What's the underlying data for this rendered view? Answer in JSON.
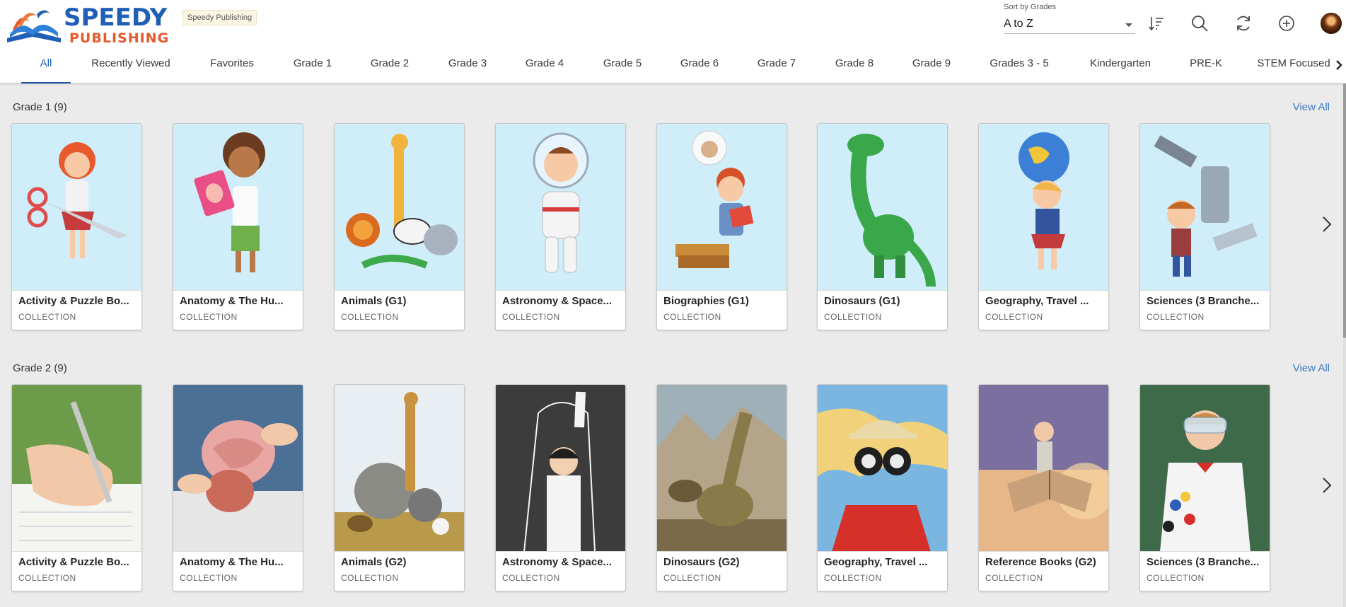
{
  "brand": {
    "line1": "SPEEDY",
    "line2": "PUBLISHING",
    "tenant_badge": "Speedy Publishing",
    "colors": {
      "blue": "#1f5fb8",
      "orange": "#e8592a"
    }
  },
  "sort": {
    "label": "Sort by Grades",
    "value": "A to Z"
  },
  "toolbar": {
    "icons": [
      "sort-order-icon",
      "search-icon",
      "refresh-icon",
      "add-icon",
      "avatar"
    ]
  },
  "tabs": [
    {
      "label": "All",
      "active": true
    },
    {
      "label": "Recently Viewed"
    },
    {
      "label": "Favorites"
    },
    {
      "label": "Grade 1"
    },
    {
      "label": "Grade 2"
    },
    {
      "label": "Grade 3"
    },
    {
      "label": "Grade 4"
    },
    {
      "label": "Grade 5"
    },
    {
      "label": "Grade 6"
    },
    {
      "label": "Grade 7"
    },
    {
      "label": "Grade 8"
    },
    {
      "label": "Grade 9"
    },
    {
      "label": "Grades 3 - 5"
    },
    {
      "label": "Kindergarten"
    },
    {
      "label": "PRE-K"
    },
    {
      "label": "STEM Focused"
    }
  ],
  "sections": [
    {
      "title": "Grade 1 (9)",
      "view_all": "View All",
      "cards": [
        {
          "title": "Activity & Puzzle Bo...",
          "type": "COLLECTION"
        },
        {
          "title": "Anatomy & The Hu...",
          "type": "COLLECTION"
        },
        {
          "title": "Animals (G1)",
          "type": "COLLECTION"
        },
        {
          "title": "Astronomy & Space...",
          "type": "COLLECTION"
        },
        {
          "title": "Biographies (G1)",
          "type": "COLLECTION"
        },
        {
          "title": "Dinosaurs (G1)",
          "type": "COLLECTION"
        },
        {
          "title": "Geography, Travel ...",
          "type": "COLLECTION"
        },
        {
          "title": "Sciences (3 Branche...",
          "type": "COLLECTION"
        }
      ]
    },
    {
      "title": "Grade 2 (9)",
      "view_all": "View All",
      "cards": [
        {
          "title": "Activity & Puzzle Bo...",
          "type": "COLLECTION"
        },
        {
          "title": "Anatomy & The Hu...",
          "type": "COLLECTION"
        },
        {
          "title": "Animals (G2)",
          "type": "COLLECTION"
        },
        {
          "title": "Astronomy & Space...",
          "type": "COLLECTION"
        },
        {
          "title": "Dinosaurs (G2)",
          "type": "COLLECTION"
        },
        {
          "title": "Geography, Travel ...",
          "type": "COLLECTION"
        },
        {
          "title": "Reference Books (G2)",
          "type": "COLLECTION"
        },
        {
          "title": "Sciences (3 Branche...",
          "type": "COLLECTION"
        }
      ]
    }
  ]
}
